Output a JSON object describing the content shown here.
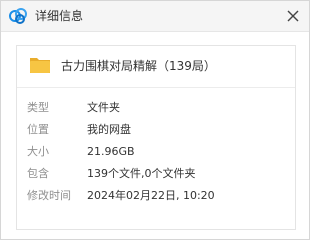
{
  "window": {
    "title": "详细信息"
  },
  "icons": {
    "app": "cloud-logo-icon",
    "close": "close-icon",
    "folder": "folder-icon",
    "colors": {
      "cloud": "#1a8ee8",
      "folder": "#f7c543"
    }
  },
  "file": {
    "name": "古力围棋对局精解（139局）"
  },
  "details": [
    {
      "label": "类型",
      "value": "文件夹"
    },
    {
      "label": "位置",
      "value": "我的网盘"
    },
    {
      "label": "大小",
      "value": "21.96GB"
    },
    {
      "label": "包含",
      "value": "139个文件,0个文件夹"
    },
    {
      "label": "修改时间",
      "value": "2024年02月22日, 10:20"
    }
  ]
}
